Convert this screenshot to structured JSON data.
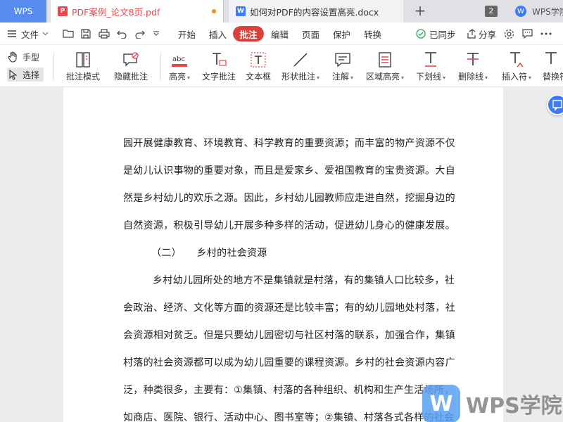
{
  "tabbar": {
    "brand": "WPS",
    "tabs": [
      {
        "label": "PDF案例_论文8页.pdf",
        "icon": "pdf-icon"
      },
      {
        "label": "如何对PDF的内容设置高亮.docx",
        "icon": "doc-icon"
      }
    ],
    "new_tab": "+",
    "tab_count": "2",
    "account": "WPS学院"
  },
  "menubar": {
    "file": "文件",
    "menus": [
      "开始",
      "插入",
      "批注",
      "编辑",
      "页面",
      "保护",
      "转换"
    ],
    "active_menu": "批注",
    "sync": "已同步",
    "share": "分享"
  },
  "ribbon": {
    "modes": {
      "hand": "手型",
      "select": "选择"
    },
    "tools": [
      {
        "label": "批注模式",
        "icon": "annotation-mode-icon"
      },
      {
        "label": "隐藏批注",
        "icon": "hide-annotation-icon"
      },
      {
        "label": "高亮",
        "icon": "highlight-icon"
      },
      {
        "label": "文字批注",
        "icon": "text-annotation-icon"
      },
      {
        "label": "文本框",
        "icon": "textbox-icon"
      },
      {
        "label": "形状批注",
        "icon": "shape-annotation-icon"
      },
      {
        "label": "注解",
        "icon": "note-icon"
      },
      {
        "label": "区域高亮",
        "icon": "area-highlight-icon"
      },
      {
        "label": "下划线",
        "icon": "underline-icon"
      },
      {
        "label": "删除线",
        "icon": "strikethrough-icon"
      },
      {
        "label": "插入符",
        "icon": "insert-caret-icon"
      },
      {
        "label": "替换符",
        "icon": "replace-caret-icon"
      }
    ]
  },
  "document": {
    "lines": [
      "园开展健康教育、环境教育、科学教育的重要资源；而丰富的物产资源不仅",
      "是幼儿认识事物的重要对象，而且是爱家乡、爱祖国教育的宝贵资源。大自",
      "然是乡村幼儿的欢乐之源。因此，乡村幼儿园教师应走进自然，挖掘身边的",
      "自然资源，积极引导幼儿开展多种多样的活动，促进幼儿身心的健康发展。",
      "（二）　　乡村的社会资源",
      "乡村幼儿园所处的地方不是集镇就是村落，有的集镇人口比较多，社",
      "会政治、经济、文化等方面的资源还是比较丰富；有的幼儿园地处村落，社",
      "会资源相对贫乏。但是只要幼儿园密切与社区村落的联系，加强合作，集镇",
      "村落的社会资源都可以成为幼儿园重要的课程资源。乡村的社会资源内容广",
      "泛，种类很多，主要有：①集镇、村落的各种组织、机构和生产生活场所，",
      "如商店、医院、银行、活动中心、图书室等；②集镇、村落各式各样的社会"
    ]
  },
  "watermark": "WPS学院"
}
